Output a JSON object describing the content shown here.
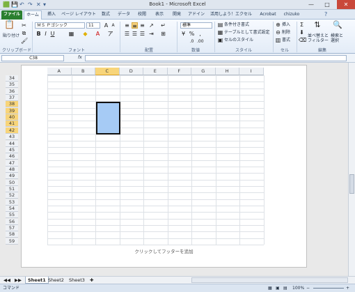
{
  "window": {
    "title": "Book1 - Microsoft Excel"
  },
  "qat": {
    "save": "💾",
    "undo": "↶",
    "redo": "↷",
    "close_x": "✕",
    "more": "▾"
  },
  "window_controls": {
    "minimize": "—",
    "maximize": "□",
    "close": "✕"
  },
  "ribbon_tabs": [
    "ファイル",
    "ホーム",
    "挿入",
    "ページ レイアウト",
    "数式",
    "データ",
    "校閲",
    "表示",
    "開発",
    "アドイン",
    "活用しよう！エクセル",
    "Acrobat",
    "chizuko"
  ],
  "ribbon": {
    "paste": "貼り付け",
    "font_name": "ＭＳ Ｐゴシック",
    "font_size": "11",
    "number_format": "標準",
    "cond_format": "条件付き書式",
    "table_format": "テーブルとして書式設定",
    "cell_style": "セルのスタイル",
    "insert": "挿入",
    "delete": "削除",
    "format": "書式",
    "sort_filter": "並べ替えと\nフィルター",
    "find_select": "検索と\n選択",
    "groups": [
      "クリップボード",
      "フォント",
      "配置",
      "数値",
      "スタイル",
      "セル",
      "編集"
    ]
  },
  "formula_bar": {
    "name_box": "C38",
    "fx": "fx",
    "value": ""
  },
  "columns": [
    "A",
    "B",
    "C",
    "D",
    "E",
    "F",
    "G",
    "H",
    "I"
  ],
  "rows": [
    "34",
    "35",
    "36",
    "37",
    "38",
    "39",
    "40",
    "41",
    "42",
    "43",
    "44",
    "45",
    "46",
    "47",
    "48",
    "49",
    "50",
    "51",
    "52",
    "53",
    "54",
    "55",
    "56",
    "57",
    "58",
    "59"
  ],
  "selection": {
    "column": "C",
    "rows": [
      "38",
      "39",
      "40",
      "41",
      "42"
    ]
  },
  "footer_text": "クリックしてフッターを追加",
  "sheets": [
    "Sheet1",
    "Sheet2",
    "Sheet3"
  ],
  "status": {
    "mode": "コマンド",
    "zoom": "100%"
  }
}
